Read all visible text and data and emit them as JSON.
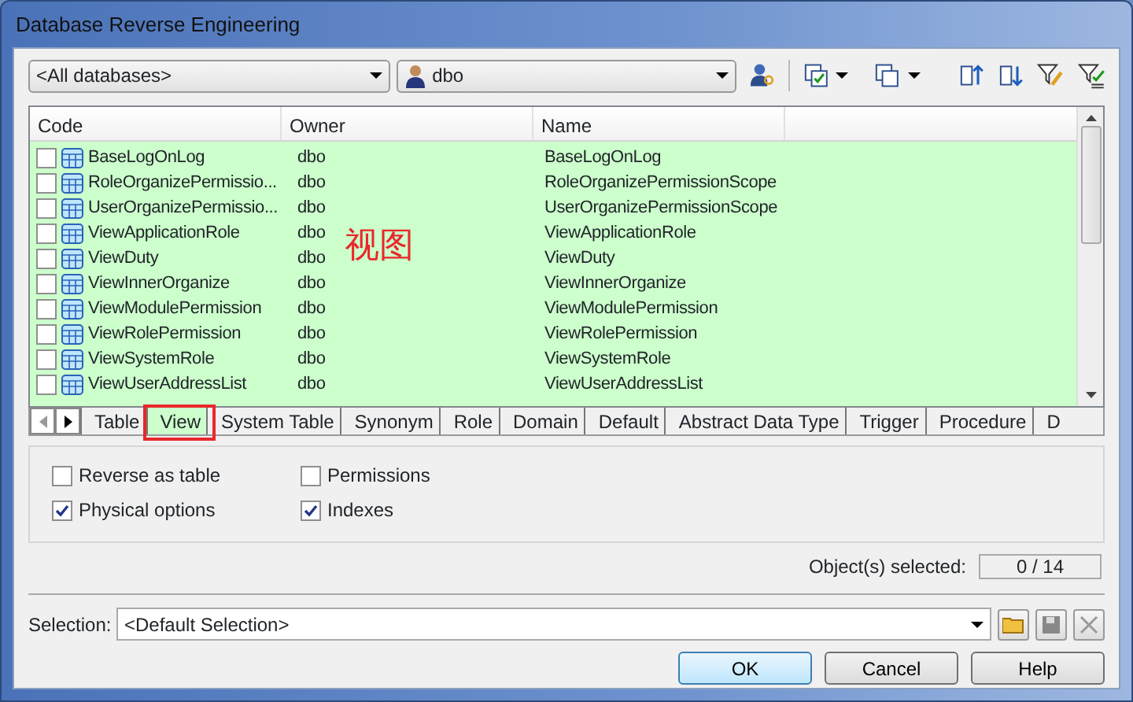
{
  "window": {
    "title": "Database Reverse Engineering"
  },
  "toolbar": {
    "database": "<All databases>",
    "owner": "dbo"
  },
  "list": {
    "columns": [
      "Code",
      "Owner",
      "Name"
    ],
    "rows": [
      {
        "code": "BaseLogOnLog",
        "owner": "dbo",
        "name": "BaseLogOnLog",
        "checked": false
      },
      {
        "code": "RoleOrganizePermissio...",
        "owner": "dbo",
        "name": "RoleOrganizePermissionScope",
        "checked": false
      },
      {
        "code": "UserOrganizePermissio...",
        "owner": "dbo",
        "name": "UserOrganizePermissionScope",
        "checked": false
      },
      {
        "code": "ViewApplicationRole",
        "owner": "dbo",
        "name": "ViewApplicationRole",
        "checked": false
      },
      {
        "code": "ViewDuty",
        "owner": "dbo",
        "name": "ViewDuty",
        "checked": false
      },
      {
        "code": "ViewInnerOrganize",
        "owner": "dbo",
        "name": "ViewInnerOrganize",
        "checked": false
      },
      {
        "code": "ViewModulePermission",
        "owner": "dbo",
        "name": "ViewModulePermission",
        "checked": false
      },
      {
        "code": "ViewRolePermission",
        "owner": "dbo",
        "name": "ViewRolePermission",
        "checked": false
      },
      {
        "code": "ViewSystemRole",
        "owner": "dbo",
        "name": "ViewSystemRole",
        "checked": false
      },
      {
        "code": "ViewUserAddressList",
        "owner": "dbo",
        "name": "ViewUserAddressList",
        "checked": false
      }
    ],
    "annotation": "视图"
  },
  "tabs": [
    {
      "label": "Table",
      "selected": false,
      "highlighted": false
    },
    {
      "label": "View",
      "selected": true,
      "highlighted": true
    },
    {
      "label": "System Table",
      "selected": false,
      "highlighted": false
    },
    {
      "label": "Synonym",
      "selected": false,
      "highlighted": false
    },
    {
      "label": "Role",
      "selected": false,
      "highlighted": false
    },
    {
      "label": "Domain",
      "selected": false,
      "highlighted": false
    },
    {
      "label": "Default",
      "selected": false,
      "highlighted": false
    },
    {
      "label": "Abstract Data Type",
      "selected": false,
      "highlighted": false
    },
    {
      "label": "Trigger",
      "selected": false,
      "highlighted": false
    },
    {
      "label": "Procedure",
      "selected": false,
      "highlighted": false
    },
    {
      "label": "D",
      "selected": false,
      "highlighted": false
    }
  ],
  "options": [
    {
      "label": "Reverse as table",
      "checked": false
    },
    {
      "label": "Permissions",
      "checked": false
    },
    {
      "label": "Physical options",
      "checked": true
    },
    {
      "label": "Indexes",
      "checked": true
    }
  ],
  "objects_selected": {
    "label": "Object(s) selected:",
    "value": "0 / 14"
  },
  "selection": {
    "label": "Selection:",
    "value": "<Default Selection>"
  },
  "buttons": [
    "OK",
    "Cancel",
    "Help"
  ]
}
